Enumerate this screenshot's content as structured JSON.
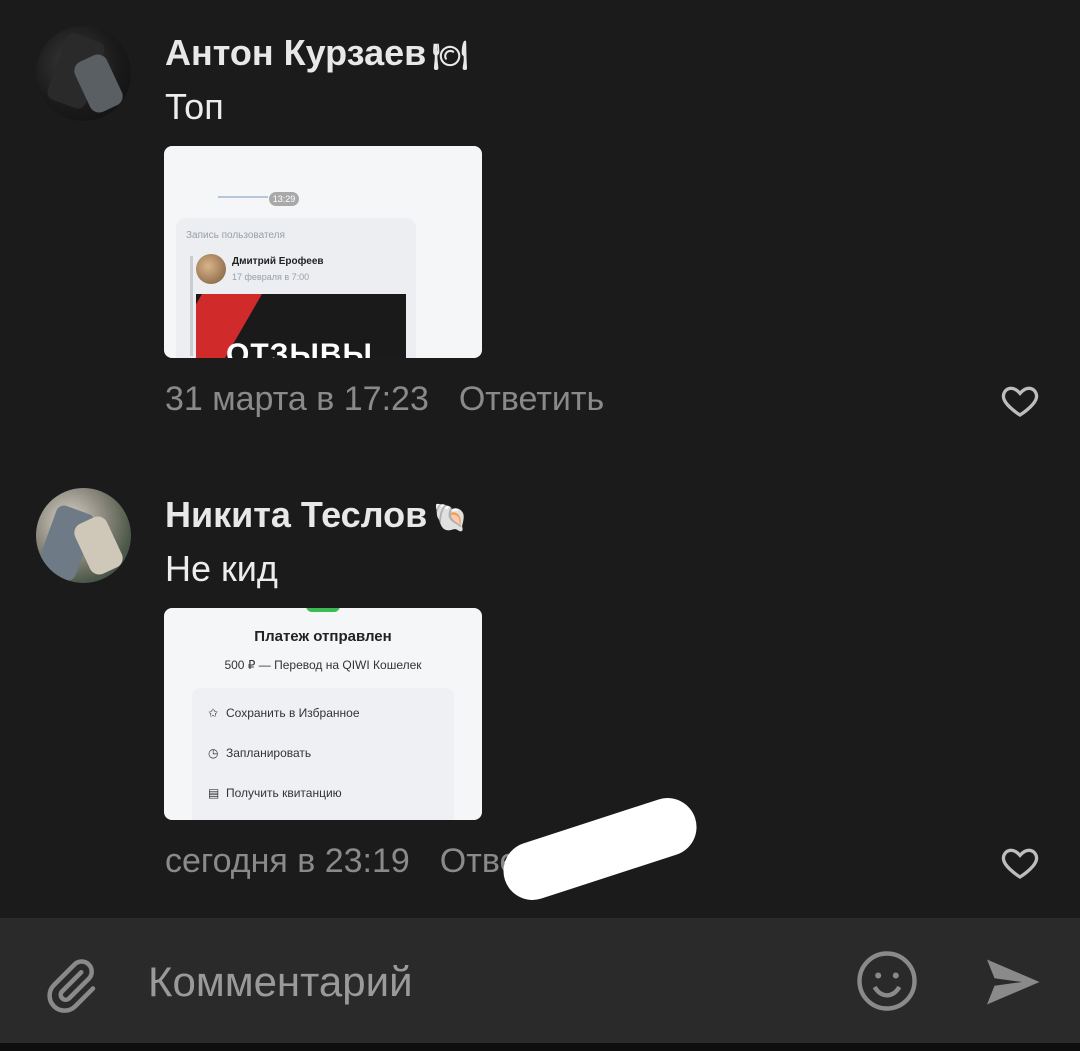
{
  "comments": [
    {
      "author": "Антон Курзаев",
      "badge": "🍽",
      "text": "Топ",
      "attachment": {
        "time_pill": "13:29",
        "card_label": "Запись пользователя",
        "post_author": "Дмитрий Ерофеев",
        "post_date": "17 февраля в 7:00",
        "promo_word": "ОТЗЫВЫ"
      },
      "date": "31 марта в 17:23",
      "reply_label": "Ответить"
    },
    {
      "author": "Никита Теслов",
      "badge": "🐚",
      "text": "Не кид",
      "attachment": {
        "title": "Платеж отправлен",
        "subtitle": "500 ₽ — Перевод на QIWI Кошелек",
        "items": [
          {
            "icon": "star-icon",
            "glyph": "✩",
            "label": "Сохранить в Избранное"
          },
          {
            "icon": "clock-icon",
            "glyph": "◷",
            "label": "Запланировать"
          },
          {
            "icon": "receipt-icon",
            "glyph": "▤",
            "label": "Получить квитанцию"
          }
        ]
      },
      "date": "сегодня в 23:19",
      "reply_label": "Ответить"
    }
  ],
  "composer": {
    "placeholder": "Комментарий",
    "attach_icon": "paperclip-icon",
    "emoji_icon": "smile-icon",
    "send_icon": "send-icon"
  },
  "colors": {
    "background": "#1b1b1b",
    "composer": "#2a2a2a",
    "muted": "#8a8a8a"
  }
}
